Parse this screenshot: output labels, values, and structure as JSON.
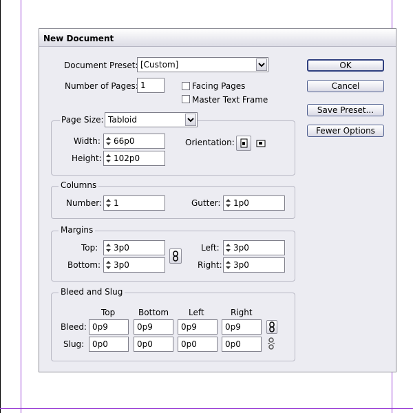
{
  "dialog": {
    "title": "New Document",
    "document_preset": {
      "label": "Document Preset:",
      "value": "[Custom]"
    },
    "number_of_pages": {
      "label": "Number of Pages:",
      "value": "1"
    },
    "facing_pages": {
      "label": "Facing Pages",
      "checked": false
    },
    "master_text_frame": {
      "label": "Master Text Frame",
      "checked": false
    },
    "buttons": {
      "ok": "OK",
      "cancel": "Cancel",
      "save_preset": "Save Preset...",
      "fewer_options": "Fewer Options"
    },
    "page_size": {
      "label": "Page Size:",
      "value": "Tabloid",
      "width_label": "Width:",
      "width_value": "66p0",
      "height_label": "Height:",
      "height_value": "102p0",
      "orientation_label": "Orientation:"
    },
    "columns": {
      "legend": "Columns",
      "number_label": "Number:",
      "number_value": "1",
      "gutter_label": "Gutter:",
      "gutter_value": "1p0"
    },
    "margins": {
      "legend": "Margins",
      "top_label": "Top:",
      "top_value": "3p0",
      "bottom_label": "Bottom:",
      "bottom_value": "3p0",
      "left_label": "Left:",
      "left_value": "3p0",
      "right_label": "Right:",
      "right_value": "3p0"
    },
    "bleed_slug": {
      "legend": "Bleed and Slug",
      "headers": [
        "Top",
        "Bottom",
        "Left",
        "Right"
      ],
      "bleed_label": "Bleed:",
      "bleed_values": [
        "0p9",
        "0p9",
        "0p9",
        "0p9"
      ],
      "slug_label": "Slug:",
      "slug_values": [
        "0p0",
        "0p0",
        "0p0",
        "0p0"
      ]
    }
  },
  "colors": {
    "guide": "#9b3fd6",
    "dialog_bg": "#ececf2",
    "button_border": "#4f5f8f"
  }
}
